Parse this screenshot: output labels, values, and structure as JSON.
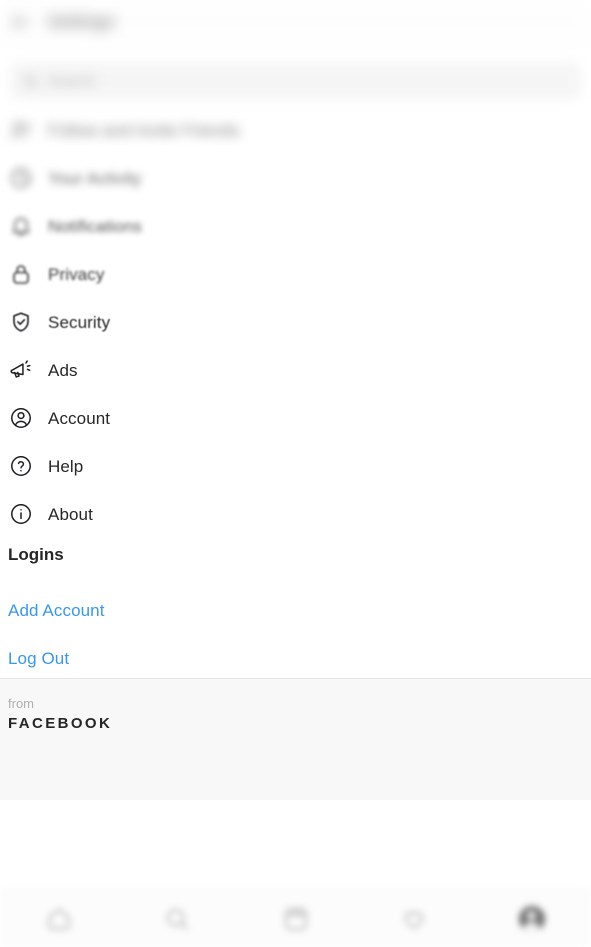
{
  "header": {
    "title": "Settings",
    "back_icon": "back-arrow-icon"
  },
  "search": {
    "placeholder": "Search",
    "value": "",
    "icon": "search-icon"
  },
  "menu": {
    "items": [
      {
        "label": "Follow and Invite Friends",
        "icon": "follow-invite-icon",
        "blur": "b-xl"
      },
      {
        "label": "Your Activity",
        "icon": "clock-icon",
        "blur": "b-l"
      },
      {
        "label": "Notifications",
        "icon": "bell-icon",
        "blur": "b-m"
      },
      {
        "label": "Privacy",
        "icon": "lock-icon",
        "blur": "b-s"
      },
      {
        "label": "Security",
        "icon": "shield-check-icon",
        "blur": "b-xs"
      },
      {
        "label": "Ads",
        "icon": "megaphone-icon",
        "blur": ""
      },
      {
        "label": "Account",
        "icon": "account-circle-icon",
        "blur": ""
      },
      {
        "label": "Help",
        "icon": "question-circle-icon",
        "blur": ""
      },
      {
        "label": "About",
        "icon": "info-circle-icon",
        "blur": ""
      }
    ]
  },
  "logins": {
    "heading": "Logins",
    "add_account": "Add Account",
    "log_out": "Log Out"
  },
  "footer": {
    "from": "from",
    "brand": "FACEBOOK"
  },
  "bottom_nav": {
    "items": [
      {
        "name": "home",
        "icon": "home-icon",
        "active": false
      },
      {
        "name": "search",
        "icon": "search-icon",
        "active": false
      },
      {
        "name": "reels",
        "icon": "reels-icon",
        "active": false
      },
      {
        "name": "activity",
        "icon": "heart-icon",
        "active": false
      },
      {
        "name": "profile",
        "icon": "avatar-icon",
        "active": true
      }
    ]
  },
  "colors": {
    "link": "#3897f0",
    "text": "#262626",
    "muted": "#8e8e8e",
    "footer_bg": "#f8f8f8",
    "search_bg": "#efefef"
  }
}
